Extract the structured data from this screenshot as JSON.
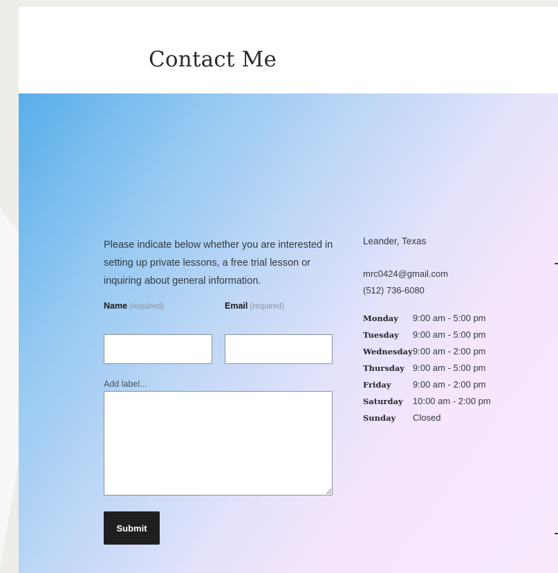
{
  "header": {
    "title": "Contact Me"
  },
  "form": {
    "intro": "Please indicate below whether you are interested in setting up private lessons, a free trial lesson or inquiring about general information.",
    "name_label": "Name",
    "name_required": "(required)",
    "name_value": "",
    "email_label": "Email",
    "email_required": "(required)",
    "email_value": "",
    "message_label": "Add label...",
    "message_value": "",
    "submit_label": "Submit"
  },
  "info": {
    "location": "Leander, Texas",
    "email": "mrc0424@gmail.com",
    "phone": "(512) 736-6080",
    "hours": [
      {
        "day": "Monday",
        "time": "9:00 am - 5:00 pm"
      },
      {
        "day": "Tuesday",
        "time": "9:00 am - 5:00 pm"
      },
      {
        "day": "Wednesday",
        "time": "9:00 am - 2:00 pm"
      },
      {
        "day": "Thursday",
        "time": "9:00 am - 5:00 pm"
      },
      {
        "day": "Friday",
        "time": "9:00 am - 2:00 pm"
      },
      {
        "day": "Saturday",
        "time": "10:00 am - 2:00 pm"
      },
      {
        "day": "Sunday",
        "time": "Closed"
      }
    ]
  },
  "colors": {
    "page_background": "#efede8",
    "gradient_start": "#58aeea",
    "gradient_end": "#f7e8fc",
    "button_background": "#1f1f1f",
    "text": "#333a40"
  }
}
